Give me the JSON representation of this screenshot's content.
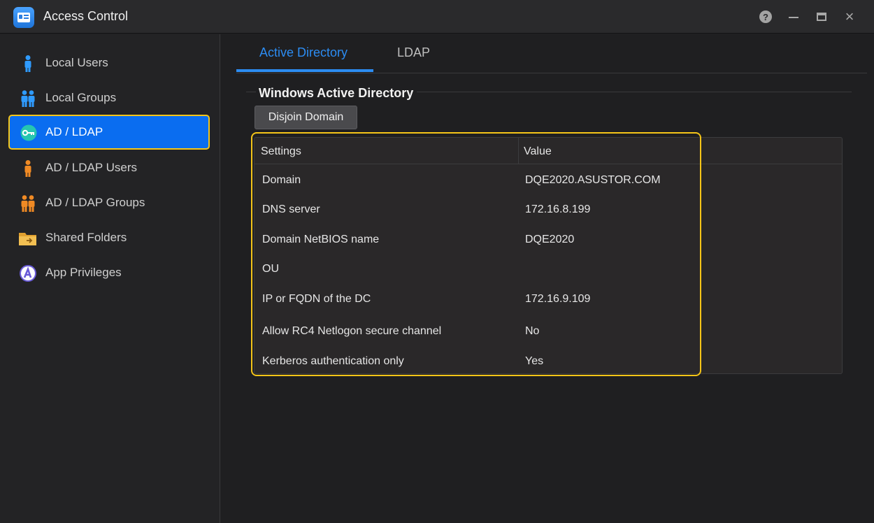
{
  "window": {
    "title": "Access Control",
    "accent_color": "#0a6df0",
    "highlight_color": "#f5c518"
  },
  "sidebar": {
    "items": [
      {
        "label": "Local Users",
        "icon": "user-icon"
      },
      {
        "label": "Local Groups",
        "icon": "users-group-icon"
      },
      {
        "label": "AD / LDAP",
        "icon": "key-icon",
        "active": true
      },
      {
        "label": "AD / LDAP Users",
        "icon": "ad-user-icon"
      },
      {
        "label": "AD / LDAP Groups",
        "icon": "ad-group-icon"
      },
      {
        "label": "Shared Folders",
        "icon": "folder-icon"
      },
      {
        "label": "App Privileges",
        "icon": "app-privileges-icon"
      }
    ]
  },
  "tabs": [
    {
      "label": "Active Directory",
      "active": true
    },
    {
      "label": "LDAP"
    }
  ],
  "section": {
    "title": "Windows Active Directory",
    "disjoin_label": "Disjoin Domain"
  },
  "grid": {
    "headers": [
      "Settings",
      "Value"
    ],
    "rows": [
      {
        "setting": "Domain",
        "value": "DQE2020.ASUSTOR.COM"
      },
      {
        "setting": "DNS server",
        "value": "172.16.8.199"
      },
      {
        "setting": "Domain NetBIOS name",
        "value": "DQE2020"
      },
      {
        "setting": "OU",
        "value": ""
      },
      {
        "setting": "IP or FQDN of the DC",
        "value": "172.16.9.109"
      },
      {
        "setting": "Allow RC4 Netlogon secure channel",
        "value": "No"
      },
      {
        "setting": "Kerberos authentication only",
        "value": "Yes"
      }
    ]
  }
}
